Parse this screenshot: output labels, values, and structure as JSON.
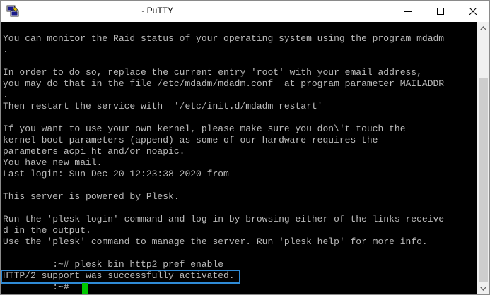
{
  "window": {
    "title": " - PuTTY",
    "icons": {
      "app": "putty-icon",
      "minimize": "minimize-icon",
      "maximize": "maximize-icon",
      "close": "close-icon"
    }
  },
  "terminal": {
    "lines": [
      "You can monitor the Raid status of your operating system using the program mdadm",
      ".",
      "",
      "In order to do so, replace the current entry 'root' with your email address,",
      "you may do that in the file /etc/mdadm/mdadm.conf  at program parameter MAILADDR",
      ".",
      "Then restart the service with  '/etc/init.d/mdadm restart'",
      "",
      "If you want to use your own kernel, please make sure you don\\'t touch the",
      "kernel boot parameters (append) as some of our hardware requires the",
      "parameters acpi=ht and/or noapic.",
      "You have new mail.",
      "Last login: Sun Dec 20 12:23:38 2020 from",
      "",
      "This server is powered by Plesk.",
      "",
      "Run the 'plesk login' command and log in by browsing either of the links receive",
      "d in the output.",
      "Use the 'plesk' command to manage the server. Run 'plesk help' for more info.",
      "",
      "         :~# plesk bin http2 pref enable",
      "HTTP/2 support was successfully activated.",
      "         :~# "
    ],
    "highlighted_line_index": 21,
    "colors": {
      "background": "#000000",
      "text": "#bbbbbb",
      "cursor": "#00c800",
      "highlight": "#2f8bd6"
    }
  },
  "scrollbar": {
    "up_icon": "scroll-up-arrow-icon",
    "down_icon": "scroll-down-arrow-icon"
  }
}
